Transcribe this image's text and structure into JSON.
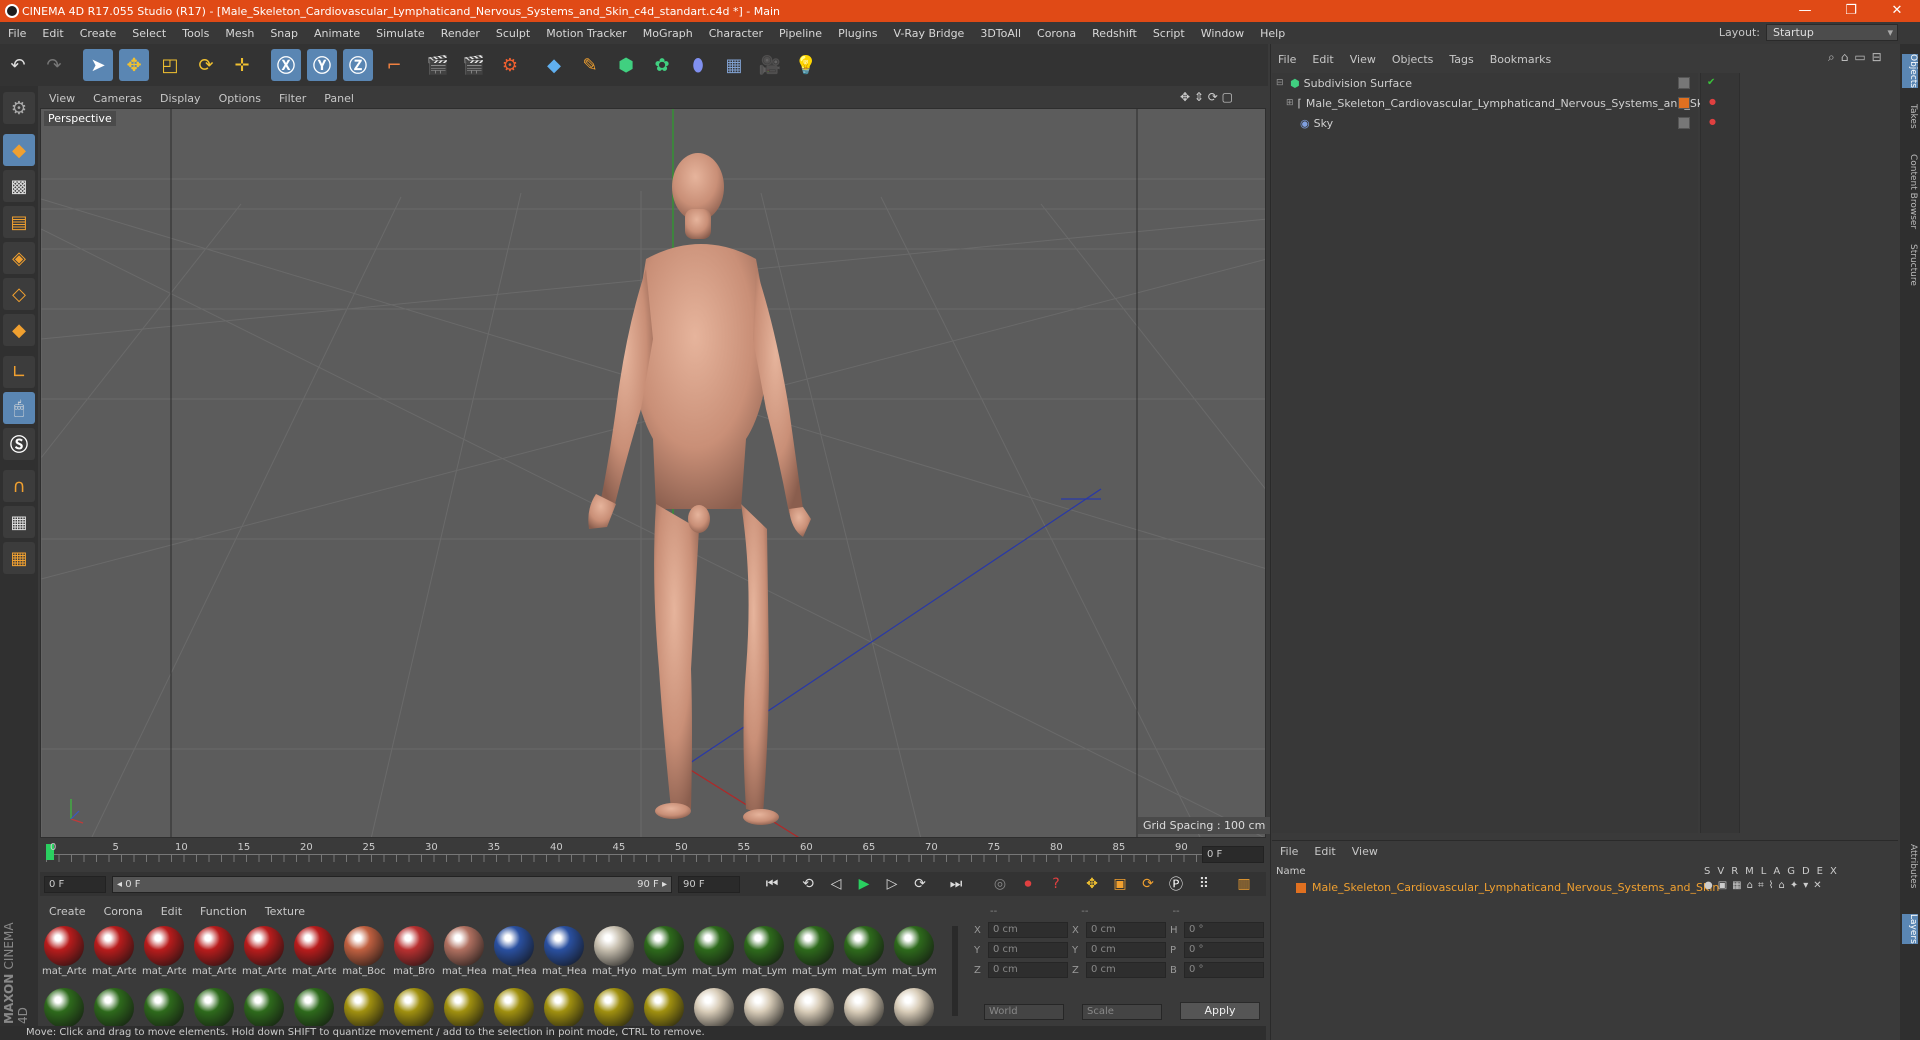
{
  "window": {
    "title": "CINEMA 4D R17.055 Studio (R17) - [Male_Skeleton_Cardiovascular_Lymphaticand_Nervous_Systems_and_Skin_c4d_standart.c4d *] - Main",
    "minimize": "—",
    "restore": "❐",
    "close": "✕"
  },
  "menubar": [
    "File",
    "Edit",
    "Create",
    "Select",
    "Tools",
    "Mesh",
    "Snap",
    "Animate",
    "Simulate",
    "Render",
    "Sculpt",
    "Motion Tracker",
    "MoGraph",
    "Character",
    "Pipeline",
    "Plugins",
    "V-Ray Bridge",
    "3DToAll",
    "Corona",
    "Redshift",
    "Script",
    "Window",
    "Help"
  ],
  "layout": {
    "label": "Layout:",
    "value": "Startup"
  },
  "viewport": {
    "menu": [
      "View",
      "Cameras",
      "Display",
      "Options",
      "Filter",
      "Panel"
    ],
    "label": "Perspective",
    "grid_spacing": "Grid Spacing : 100 cm"
  },
  "timeline": {
    "ticks": [
      "0",
      "5",
      "10",
      "15",
      "20",
      "25",
      "30",
      "35",
      "40",
      "45",
      "50",
      "55",
      "60",
      "65",
      "70",
      "75",
      "80",
      "85",
      "90"
    ],
    "current_frame": "0 F",
    "start_frame": "0 F",
    "range_start": "◂ 0 F",
    "range_end": "90 F ▸",
    "end_frame": "90 F"
  },
  "materials": {
    "menu": [
      "Create",
      "Corona",
      "Edit",
      "Function",
      "Texture"
    ],
    "row1": [
      {
        "label": "mat_Arte",
        "color": "#b81c1c"
      },
      {
        "label": "mat_Arte",
        "color": "#b81c1c"
      },
      {
        "label": "mat_Arte",
        "color": "#b81c1c"
      },
      {
        "label": "mat_Arte",
        "color": "#b81c1c"
      },
      {
        "label": "mat_Arte",
        "color": "#b81c1c"
      },
      {
        "label": "mat_Arte",
        "color": "#b81c1c"
      },
      {
        "label": "mat_Boc",
        "color": "#c06040"
      },
      {
        "label": "mat_Bro",
        "color": "#b83030"
      },
      {
        "label": "mat_Hea",
        "color": "#b07060"
      },
      {
        "label": "mat_Hea",
        "color": "#2a50a0"
      },
      {
        "label": "mat_Hea",
        "color": "#2a50a0"
      },
      {
        "label": "mat_Hyo",
        "color": "#c8c0b0"
      },
      {
        "label": "mat_Lym",
        "color": "#2e6a1c"
      },
      {
        "label": "mat_Lym",
        "color": "#2e6a1c"
      },
      {
        "label": "mat_Lym",
        "color": "#2e6a1c"
      },
      {
        "label": "mat_Lym",
        "color": "#2e6a1c"
      },
      {
        "label": "mat_Lym",
        "color": "#2e6a1c"
      },
      {
        "label": "mat_Lym",
        "color": "#2e6a1c"
      }
    ],
    "row2_colors": [
      "#2e6a1c",
      "#2e6a1c",
      "#2e6a1c",
      "#2e6a1c",
      "#2e6a1c",
      "#2e6a1c",
      "#a09010",
      "#a09010",
      "#a09010",
      "#a09010",
      "#a09010",
      "#a09010",
      "#a09010",
      "#d8ccb8",
      "#d8ccb8",
      "#d8ccb8",
      "#d8ccb8",
      "#d8ccb8"
    ]
  },
  "coords": {
    "headers": [
      "--",
      "--",
      "--"
    ],
    "rows": [
      {
        "a": "X",
        "av": "0 cm",
        "b": "X",
        "bv": "0 cm",
        "c": "H",
        "cv": "0 °"
      },
      {
        "a": "Y",
        "av": "0 cm",
        "b": "Y",
        "bv": "0 cm",
        "c": "P",
        "cv": "0 °"
      },
      {
        "a": "Z",
        "av": "0 cm",
        "b": "Z",
        "bv": "0 cm",
        "c": "B",
        "cv": "0 °"
      }
    ],
    "mode1": "World",
    "mode2": "Scale",
    "apply": "Apply"
  },
  "status": "Move: Click and drag to move elements. Hold down SHIFT to quantize movement / add to the selection in point mode, CTRL to remove.",
  "objects": {
    "menu": [
      "File",
      "Edit",
      "View",
      "Objects",
      "Tags",
      "Bookmarks"
    ],
    "items": [
      {
        "name": "Subdivision Surface"
      },
      {
        "name": "Male_Skeleton_Cardiovascular_Lymphaticand_Nervous_Systems_and_Skin"
      },
      {
        "name": "Sky"
      }
    ]
  },
  "sidetabs": [
    "Objects",
    "Takes",
    "Content Browser",
    "Structure",
    "Attributes",
    "Layers"
  ],
  "layers": {
    "menu": [
      "File",
      "Edit",
      "View"
    ],
    "header_name": "Name",
    "header_flags": [
      "S",
      "V",
      "R",
      "M",
      "L",
      "A",
      "G",
      "D",
      "E",
      "X"
    ],
    "row": "Male_Skeleton_Cardiovascular_Lymphaticand_Nervous_Systems_and_Skin",
    "row_color": "#e07020"
  },
  "brand": {
    "line1": "MAXON",
    "line2": "CINEMA 4D"
  }
}
